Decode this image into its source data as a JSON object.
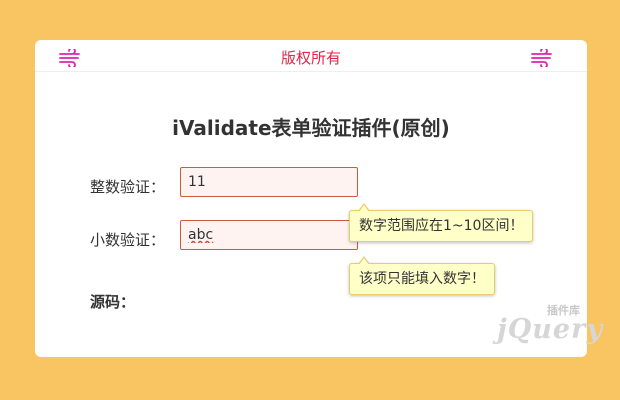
{
  "header": {
    "copyright": "版权所有",
    "left_icon": "wind-icon",
    "right_icon": "wind-icon",
    "accent_color": "#e0264a",
    "icon_color": "#e020b0"
  },
  "main": {
    "title": "iValidate表单验证插件(原创)",
    "fields": [
      {
        "label": "整数验证：",
        "value": "11"
      },
      {
        "label": "小数验证：",
        "value": "abc"
      }
    ],
    "tooltips": [
      {
        "text": "数字范围应在1~10区间！"
      },
      {
        "text": "该项只能填入数字！"
      }
    ],
    "source_label": "源码："
  },
  "watermark": {
    "text": "插件库",
    "logo": "jQuery"
  }
}
